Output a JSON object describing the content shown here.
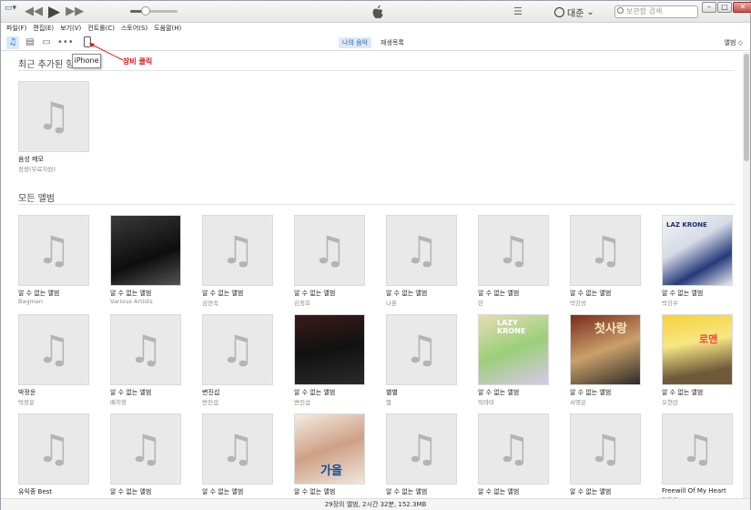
{
  "titlebar": {
    "sysmenu_glyph": "▭▾",
    "user_name": "대준",
    "search_placeholder": "보관함 검색",
    "window_buttons": [
      "–",
      "□",
      "✕"
    ]
  },
  "menu": [
    "파일(F)",
    "편집(E)",
    "보기(V)",
    "컨트롤(C)",
    "스토어(S)",
    "도움말(H)"
  ],
  "toolbar": {
    "tabs": [
      {
        "label": "나의 음악",
        "active": true
      },
      {
        "label": "재생목록",
        "active": false
      }
    ],
    "view_label": "앨범 ◇",
    "tooltip": "iPhone",
    "annotation": "장비 클릭"
  },
  "recent": {
    "title": "최근 추가된 항목",
    "items": [
      {
        "title": "음성 메모",
        "artist": "정량(무료자원)"
      }
    ]
  },
  "all_albums": {
    "title": "모든 앨범",
    "items": [
      {
        "title": "알 수 없는 앨범",
        "artist": "Bagman"
      },
      {
        "title": "알 수 없는 앨범",
        "artist": "Various Artists",
        "art": "c1"
      },
      {
        "title": "알 수 없는 앨범",
        "artist": "김연숙"
      },
      {
        "title": "알 수 없는 앨범",
        "artist": "김정호"
      },
      {
        "title": "알 수 없는 앨범",
        "artist": "나훈"
      },
      {
        "title": "알 수 없는 앨범",
        "artist": "란"
      },
      {
        "title": "알 수 없는 앨범",
        "artist": "박강성"
      },
      {
        "title": "알 수 없는 앨범",
        "artist": "박강수",
        "art": "c2"
      },
      {
        "title": "박정운",
        "artist": "박정운"
      },
      {
        "title": "알 수 없는 앨범",
        "artist": "배치영"
      },
      {
        "title": "변진섭",
        "artist": "변진섭"
      },
      {
        "title": "알 수 없는 앨범",
        "artist": "변진섭",
        "art": "c3"
      },
      {
        "title": "별별",
        "artist": "별"
      },
      {
        "title": "알 수 없는 앨범",
        "artist": "빅마마",
        "art": "c4"
      },
      {
        "title": "알 수 없는 앨범",
        "artist": "서영은",
        "art": "c5"
      },
      {
        "title": "알 수 없는 앨범",
        "artist": "오현란",
        "art": "c6"
      },
      {
        "title": "유익종 Best",
        "artist": "유익종"
      },
      {
        "title": "알 수 없는 앨범",
        "artist": "유익종"
      },
      {
        "title": "알 수 없는 앨범",
        "artist": "유심초"
      },
      {
        "title": "알 수 없는 앨범",
        "artist": "이승철",
        "art": "c7"
      },
      {
        "title": "알 수 없는 앨범",
        "artist": "이은미"
      },
      {
        "title": "알 수 없는 앨범",
        "artist": "이현우"
      },
      {
        "title": "알 수 없는 앨범",
        "artist": "임재범"
      },
      {
        "title": "Freewill Of My Heart",
        "artist": "임형주"
      }
    ]
  },
  "art_text": {
    "c2": "LAZ KRONE",
    "c4": "LAZY KRONE",
    "c5": "첫사랑",
    "c6": "로맨",
    "c7": "가을"
  },
  "status": "29장의 앨범, 2시간 32분, 152.3MB"
}
